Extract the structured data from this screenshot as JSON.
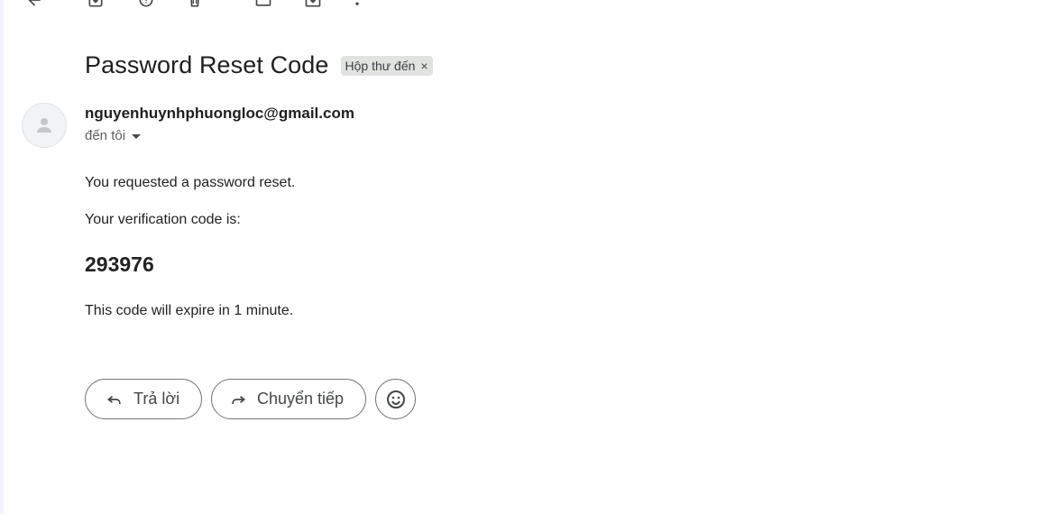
{
  "toolbar": {
    "icons": [
      "back-arrow-icon",
      "archive-icon",
      "report-spam-icon",
      "delete-icon",
      "mark-unread-icon",
      "move-to-icon",
      "more-vert-icon"
    ]
  },
  "email": {
    "subject": "Password Reset Code",
    "label": "Hộp thư đến",
    "label_remove": "×",
    "sender": "nguyenhuynhphuongloc@gmail.com",
    "recipient": "đến tôi",
    "body": {
      "line1": "You requested a password reset.",
      "line2": "Your verification code is:",
      "code": "293976",
      "line3": "This code will expire in 1 minute."
    }
  },
  "actions": {
    "reply": "Trả lời",
    "forward": "Chuyển tiếp",
    "emoji_icon": "emoji-smile-icon"
  },
  "colors": {
    "text": "#1f1f1f",
    "muted": "#5e5e5e",
    "chip_bg": "#e1e3e1",
    "border": "#747775"
  }
}
